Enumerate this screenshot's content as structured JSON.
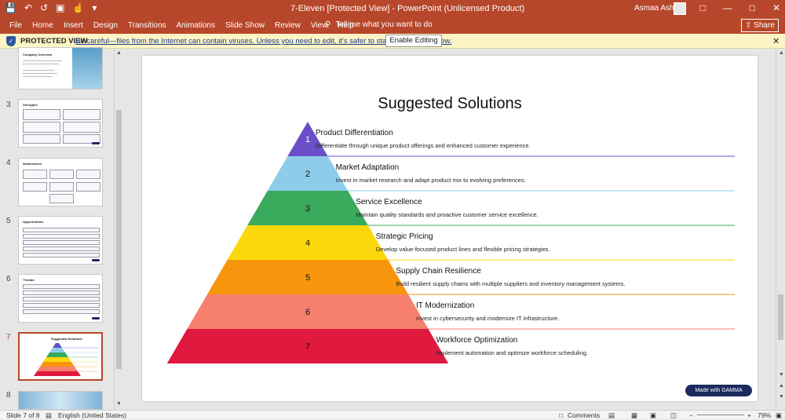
{
  "window": {
    "title": "7-Eleven [Protected View]  -  PowerPoint (Unlicensed Product)",
    "user": "Asmaa Ashraf",
    "controls": [
      "—",
      "□",
      "✕"
    ]
  },
  "quick_access": [
    "save-icon",
    "undo-icon",
    "redo-icon",
    "present-icon",
    "touch-icon",
    "customize-icon"
  ],
  "menu": {
    "tabs": [
      "File",
      "Home",
      "Insert",
      "Design",
      "Transitions",
      "Animations",
      "Slide Show",
      "Review",
      "View",
      "Help"
    ],
    "tell_me": "Tell me what you want to do",
    "share": "Share"
  },
  "protected_bar": {
    "label": "PROTECTED VIEW",
    "message": "Be careful—files from the Internet can contain viruses. Unless you need to edit, it's safer to stay in Protected View.",
    "button": "Enable Editing"
  },
  "thumbnails": [
    {
      "number": "",
      "title": "Company Overview"
    },
    {
      "number": "3",
      "title": "Strengths"
    },
    {
      "number": "4",
      "title": "Weaknesses"
    },
    {
      "number": "5",
      "title": "Opportunities"
    },
    {
      "number": "6",
      "title": "Threats"
    },
    {
      "number": "7",
      "title": "Suggested Solutions"
    },
    {
      "number": "8",
      "title": ""
    }
  ],
  "slide": {
    "title": "Suggested Solutions",
    "badge": "Made with GAMMA",
    "levels": [
      {
        "num": "1",
        "heading": "Product Differentiation",
        "desc": "Differentiate through unique product offerings and enhanced customer experience.",
        "color": "#6a4fc8",
        "line": "#6a4fc8"
      },
      {
        "num": "2",
        "heading": "Market Adaptation",
        "desc": "Invest in market research and adapt product mix to evolving preferences.",
        "color": "#8dcde9",
        "line": "#8dcde9"
      },
      {
        "num": "3",
        "heading": "Service Excellence",
        "desc": "Maintain quality standards and proactive customer service excellence.",
        "color": "#3aaa5c",
        "line": "#3aaa5c"
      },
      {
        "num": "4",
        "heading": "Strategic Pricing",
        "desc": "Develop value-focused product lines and flexible pricing strategies.",
        "color": "#fbd80c",
        "line": "#fbd80c"
      },
      {
        "num": "5",
        "heading": "Supply Chain Resilience",
        "desc": "Build resilient supply chains with multiple suppliers and inventory management systems.",
        "color": "#f7960d",
        "line": "#f7960d"
      },
      {
        "num": "6",
        "heading": "IT Modernization",
        "desc": "Invest in cybersecurity and modernize IT infrastructure.",
        "color": "#f67f6e",
        "line": "#f67f6e"
      },
      {
        "num": "7",
        "heading": "Workforce Optimization",
        "desc": "Implement automation and optimize workforce scheduling.",
        "color": "#e0193f",
        "line": "#e0193f"
      }
    ]
  },
  "status": {
    "slide_of": "Slide 7 of 8",
    "language": "English (United States)",
    "comments": "Comments",
    "zoom": "79%"
  }
}
